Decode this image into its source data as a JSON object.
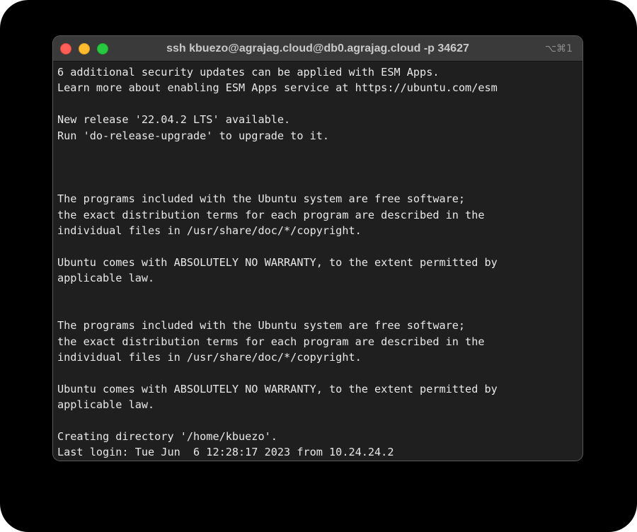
{
  "window": {
    "title": "ssh kbuezo@agrajag.cloud@db0.agrajag.cloud -p 34627",
    "shortcut": "⌥⌘1",
    "controls": {
      "close": "close-icon",
      "minimize": "minimize-icon",
      "zoom": "zoom-icon"
    },
    "colors": {
      "close": "#ff5f57",
      "minimize": "#febc2e",
      "zoom": "#28c840",
      "terminal_background": "#1f1f1f",
      "terminal_text": "#e8e8e8"
    }
  },
  "terminal": {
    "lines": [
      "6 additional security updates can be applied with ESM Apps.",
      "Learn more about enabling ESM Apps service at https://ubuntu.com/esm",
      "",
      "New release '22.04.2 LTS' available.",
      "Run 'do-release-upgrade' to upgrade to it.",
      "",
      "",
      "",
      "The programs included with the Ubuntu system are free software;",
      "the exact distribution terms for each program are described in the",
      "individual files in /usr/share/doc/*/copyright.",
      "",
      "Ubuntu comes with ABSOLUTELY NO WARRANTY, to the extent permitted by",
      "applicable law.",
      "",
      "",
      "The programs included with the Ubuntu system are free software;",
      "the exact distribution terms for each program are described in the",
      "individual files in /usr/share/doc/*/copyright.",
      "",
      "Ubuntu comes with ABSOLUTELY NO WARRANTY, to the extent permitted by",
      "applicable law.",
      "",
      "Creating directory '/home/kbuezo'.",
      "Last login: Tue Jun  6 12:28:17 2023 from 10.24.24.2"
    ]
  }
}
